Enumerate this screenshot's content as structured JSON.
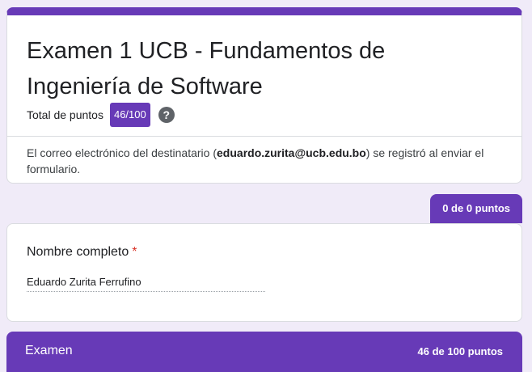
{
  "form": {
    "title": "Examen 1 UCB - Fundamentos de Ingeniería de Software",
    "total_points_label": "Total de puntos",
    "total_points_value": "46/100",
    "help_icon": "?",
    "email_note_prefix": "El correo electrónico del destinatario (",
    "email": "eduardo.zurita@ucb.edu.bo",
    "email_note_suffix": ") se registró al enviar el formulario."
  },
  "section1": {
    "points": "0 de 0 puntos",
    "question": {
      "label": "Nombre completo",
      "required_mark": "*",
      "answer": "Eduardo Zurita Ferrufino"
    }
  },
  "section2": {
    "title": "Examen",
    "points": "46 de 100 puntos"
  },
  "colors": {
    "accent": "#673ab7",
    "background": "#f0ebf8",
    "required": "#d93025"
  },
  "icons": {
    "help": "help-circle-icon"
  }
}
